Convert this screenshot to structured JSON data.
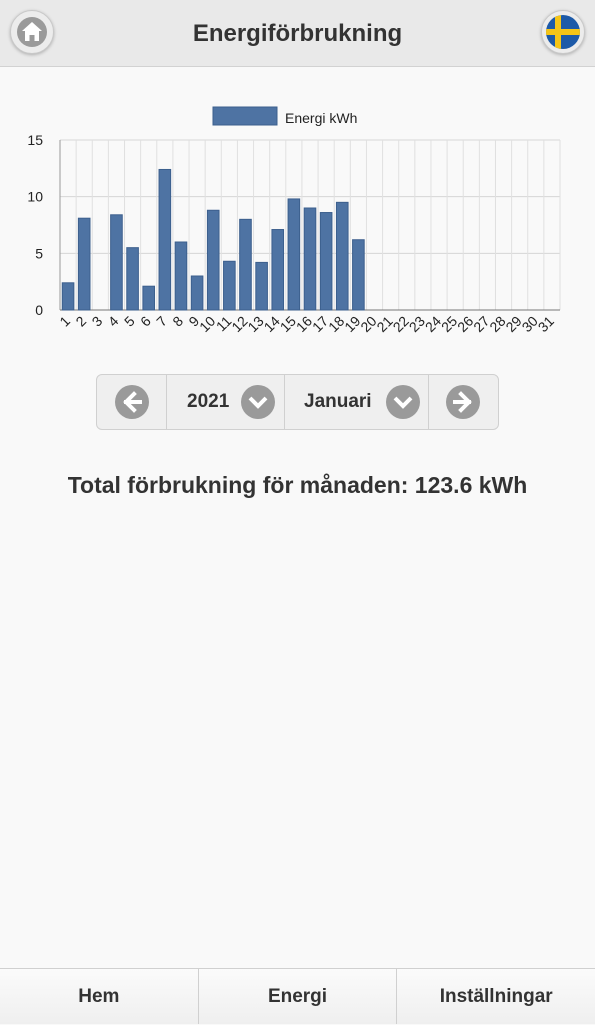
{
  "header": {
    "title": "Energiförbrukning",
    "home_icon": "home-icon",
    "language_icon": "swedish-flag-icon"
  },
  "chart_data": {
    "type": "bar",
    "legend": [
      "Energi kWh"
    ],
    "legend_placement": "top-center",
    "categories": [
      "1",
      "2",
      "3",
      "4",
      "5",
      "6",
      "7",
      "8",
      "9",
      "10",
      "11",
      "12",
      "13",
      "14",
      "15",
      "16",
      "17",
      "18",
      "19",
      "20",
      "21",
      "22",
      "23",
      "24",
      "25",
      "26",
      "27",
      "28",
      "29",
      "30",
      "31"
    ],
    "series": [
      {
        "name": "Energi kWh",
        "color": "#4e73a3",
        "values": [
          2.4,
          8.1,
          0,
          8.4,
          5.5,
          2.1,
          12.4,
          6.0,
          3.0,
          8.8,
          4.3,
          8.0,
          4.2,
          7.1,
          9.8,
          9.0,
          8.6,
          9.5,
          6.2,
          0,
          0,
          0,
          0,
          0,
          0,
          0,
          0,
          0,
          0,
          0,
          0
        ]
      }
    ],
    "yticks": [
      "0",
      "5",
      "10",
      "15"
    ],
    "ylim": [
      0,
      15
    ],
    "grid": true
  },
  "period": {
    "prev_icon": "arrow-left-icon",
    "year": "2021",
    "year_dropdown_icon": "chevron-down-icon",
    "month": "Januari",
    "month_dropdown_icon": "chevron-down-icon",
    "next_icon": "arrow-right-icon"
  },
  "total_text": "Total förbrukning för månaden: 123.6 kWh",
  "footer": {
    "tabs": [
      {
        "label": "Hem"
      },
      {
        "label": "Energi"
      },
      {
        "label": "Inställningar"
      }
    ]
  }
}
